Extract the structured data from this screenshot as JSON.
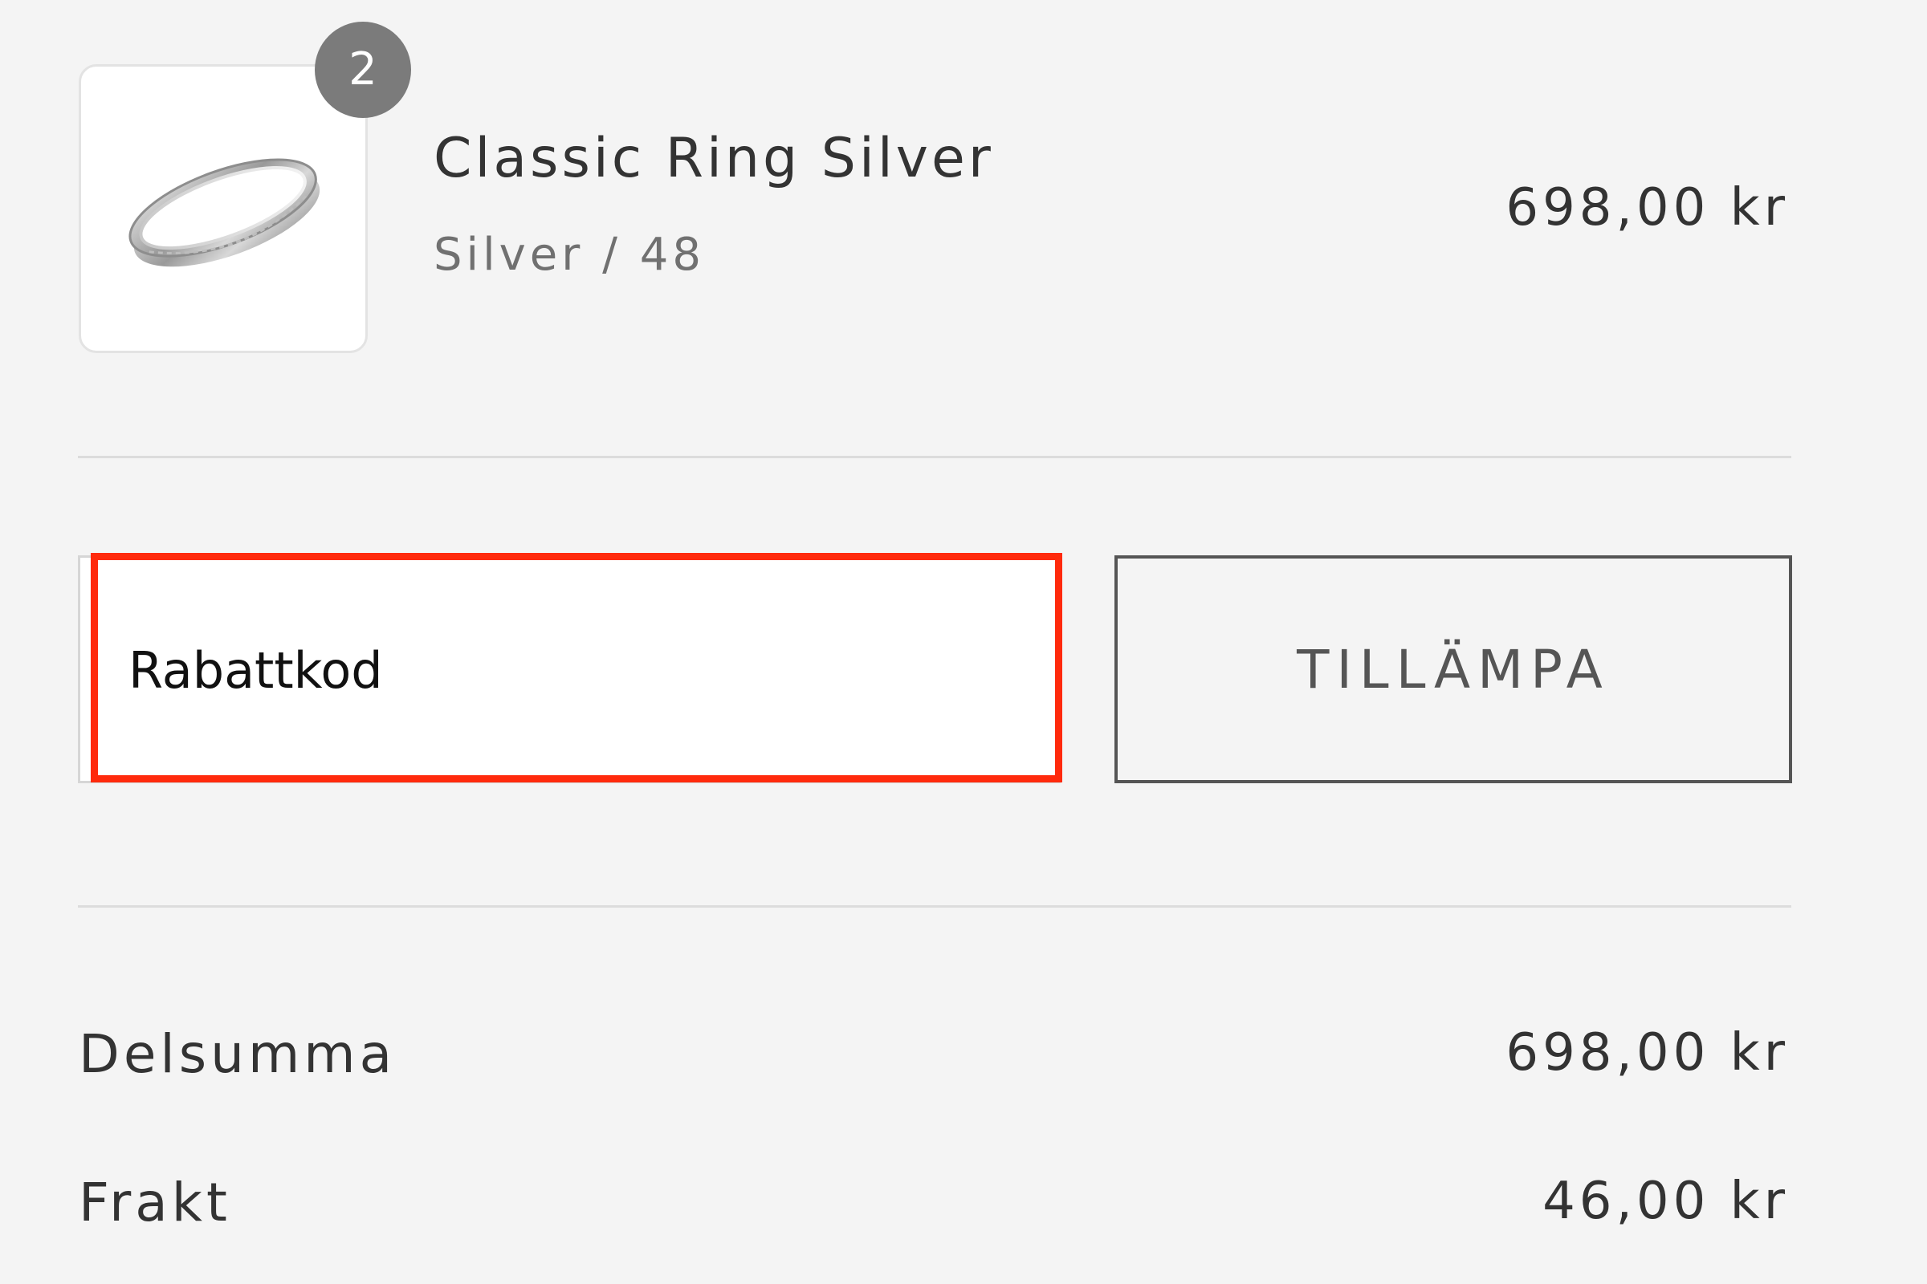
{
  "product": {
    "quantity_badge": "2",
    "name": "Classic Ring Silver",
    "variant": "Silver / 48",
    "price": "698,00 kr",
    "image_icon": "silver-ring-image"
  },
  "discount": {
    "placeholder": "Rabattkod",
    "value": "",
    "apply_label": "TILLÄMPA",
    "highlight_color": "#ff2a0c"
  },
  "summary": {
    "subtotal_label": "Delsumma",
    "subtotal_value": "698,00 kr",
    "shipping_label": "Frakt",
    "shipping_value": "46,00 kr"
  },
  "colors": {
    "background": "#f4f4f4",
    "text": "#333333",
    "muted_text": "#707070",
    "badge": "#7b7b7b"
  }
}
